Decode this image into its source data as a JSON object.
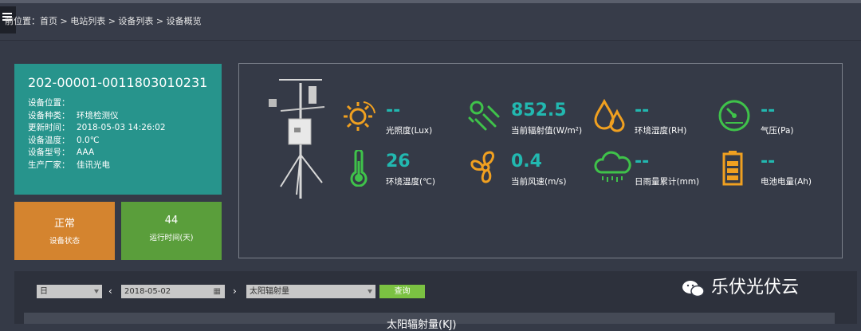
{
  "breadcrumb": {
    "text": "前位置：首页 > 电站列表 > 设备列表 > 设备概览"
  },
  "device": {
    "id": "202-00001-0011803010231",
    "rows": [
      {
        "label": "设备位置：",
        "value": ""
      },
      {
        "label": "设备种类：",
        "value": "环境检测仪"
      },
      {
        "label": "更新时间：",
        "value": "2018-05-03 14:26:02"
      },
      {
        "label": "设备温度：",
        "value": "0.0℃"
      },
      {
        "label": "设备型号：",
        "value": "AAA"
      },
      {
        "label": "生产厂家：",
        "value": "佳讯光电"
      }
    ]
  },
  "status": {
    "state_value": "正常",
    "state_label": "设备状态",
    "days_value": "44",
    "days_label": "运行时间(天)"
  },
  "metrics": {
    "lux": {
      "value": "--",
      "label": "光照度(Lux)",
      "icon": "sun-icon"
    },
    "radiation": {
      "value": "852.5",
      "label": "当前辐射值(W/m²)",
      "icon": "radiation-icon"
    },
    "humidity": {
      "value": "--",
      "label": "环境湿度(RH)",
      "icon": "drops-icon"
    },
    "pressure": {
      "value": "--",
      "label": "气压(Pa)",
      "icon": "gauge-icon"
    },
    "temperature": {
      "value": "26",
      "label": "环境温度(℃)",
      "icon": "thermometer-icon"
    },
    "wind": {
      "value": "0.4",
      "label": "当前风速(m/s)",
      "icon": "fan-icon"
    },
    "rain": {
      "value": "--",
      "label": "日雨量累计(mm)",
      "icon": "rain-cloud-icon"
    },
    "battery": {
      "value": "--",
      "label": "电池电量(Ah)",
      "icon": "battery-icon"
    }
  },
  "controls": {
    "period": "日",
    "date": "2018-05-02",
    "metric_select": "太阳辐射量",
    "query_label": "查询"
  },
  "chart_title": "太阳辐射量(KJ)",
  "watermark": "乐伏光伏云",
  "colors": {
    "accent_teal": "#27948c",
    "status_orange": "#d4842f",
    "status_green": "#5a9e3b",
    "icon_orange": "#f0a020",
    "icon_green": "#3fc24a",
    "value_teal": "#22b8b0"
  }
}
